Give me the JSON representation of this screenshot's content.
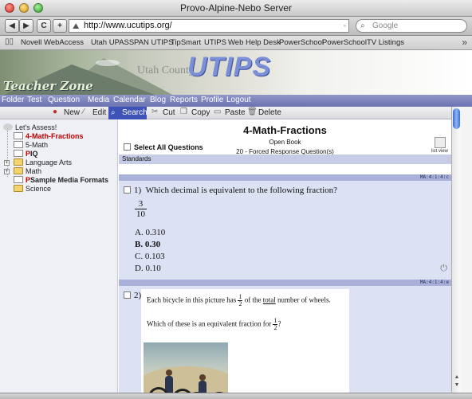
{
  "window": {
    "title": "Provo-Alpine-Nebo Server"
  },
  "browser": {
    "back_icon": "back-arrow-icon",
    "forward_icon": "forward-arrow-icon",
    "reload_label": "C",
    "add_label": "+",
    "url": "http://www.ucutips.org/",
    "search_placeholder": "Google",
    "bookmarks": [
      "Novell WebAccess",
      "Utah UPASS",
      "PAN UTIPS",
      "TipSmart",
      "UTIPS",
      "Web Help Desk",
      "PowerSchool",
      "PowerSchool",
      "TV Listings"
    ],
    "bookmarks_more": "»"
  },
  "banner": {
    "teacher_zone": "Teacher Zone",
    "county": "Utah County",
    "logo": "UTIPS"
  },
  "main_menu": [
    "Folder",
    "Test",
    "Question",
    "Media",
    "Calendar",
    "Blog",
    "Reports",
    "Profile",
    "Logout"
  ],
  "command_bar": {
    "new": "New",
    "edit": "Edit",
    "search": "Search",
    "cut": "Cut",
    "copy": "Copy",
    "paste": "Paste",
    "delete": "Delete"
  },
  "sidebar": {
    "root": "Let's Assess!",
    "items": [
      {
        "label": "4-Math-Fractions",
        "style": "bold-red"
      },
      {
        "label": "5-Math",
        "style": "normal"
      },
      {
        "label": "IQ",
        "style": "bold"
      },
      {
        "label": "Language Arts",
        "style": "normal"
      },
      {
        "label": "Math",
        "style": "normal"
      },
      {
        "label": "Sample Media Formats",
        "style": "bold"
      },
      {
        "label": "Science",
        "style": "normal"
      }
    ],
    "p_marker": "P"
  },
  "content": {
    "title": "4-Math-Fractions",
    "subtitle": "Open Book",
    "subtitle2": "20 - Forced Response Question(s)",
    "select_all": "Select All Questions",
    "list_view": "list view",
    "standards": "Standards",
    "q1": {
      "standard": "MA:4:1:4:c",
      "number": "1)",
      "text": "Which decimal is equivalent to the following fraction?",
      "frac_num": "3",
      "frac_den": "10",
      "options": [
        "A.  0.310",
        "B.  0.30",
        "C.  0.103",
        "D.  0.10"
      ],
      "bold_option_index": 1
    },
    "q2": {
      "standard": "MA:4:1:4:e",
      "number": "2)",
      "line1_a": "Each bicycle in this picture has",
      "frac_num": "1",
      "frac_den": "2",
      "line1_b": "of the",
      "line1_u": "total",
      "line1_c": "number of wheels.",
      "line2_a": "Which of these is an equivalent fraction for",
      "line2_b": "?"
    }
  },
  "colors": {
    "menu_bar": "#7c82bc",
    "question_bg": "#dde1f4",
    "search_highlight": "#3d53b8",
    "logo": "#7b8fd6"
  }
}
